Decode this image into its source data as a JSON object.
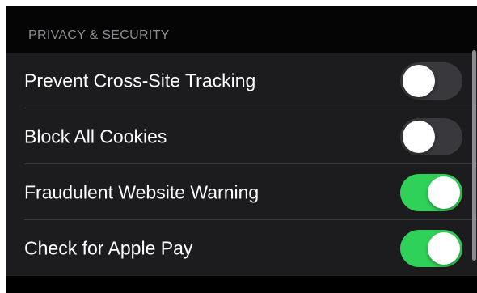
{
  "section": {
    "header": "PRIVACY & SECURITY"
  },
  "rows": [
    {
      "label": "Prevent Cross-Site Tracking",
      "toggle_on": false
    },
    {
      "label": "Block All Cookies",
      "toggle_on": false
    },
    {
      "label": "Fraudulent Website Warning",
      "toggle_on": true
    },
    {
      "label": "Check for Apple Pay",
      "toggle_on": true
    }
  ],
  "colors": {
    "background": "#000000",
    "group_background": "#1c1c1e",
    "toggle_on": "#30d158",
    "toggle_off": "#39393d",
    "header_text": "#8d8d93"
  }
}
